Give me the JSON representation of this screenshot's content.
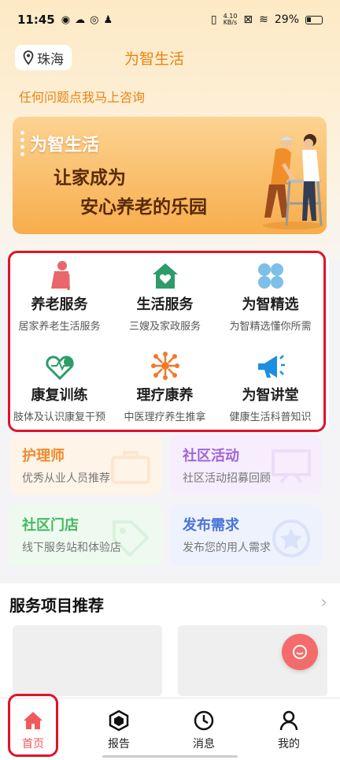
{
  "status_bar": {
    "time": "11:45",
    "net_speed_value": "4.10",
    "net_speed_unit": "KB/s",
    "battery": "29%"
  },
  "header": {
    "location": "珠海",
    "app_title": "为智生活",
    "consult_link": "任何问题点我马上咨询"
  },
  "banner": {
    "title": "为智生活",
    "line1": "让家成为",
    "line2": "安心养老的乐园"
  },
  "services": [
    {
      "title": "养老服务",
      "subtitle": "居家养老生活服务",
      "icon": "elderly-icon"
    },
    {
      "title": "生活服务",
      "subtitle": "三嫂及家政服务",
      "icon": "home-heart-icon"
    },
    {
      "title": "为智精选",
      "subtitle": "为智精选懂你所需",
      "icon": "clover-icon"
    },
    {
      "title": "康复训练",
      "subtitle": "肢体及认识康复干预",
      "icon": "heart-rehab-icon"
    },
    {
      "title": "理疗康养",
      "subtitle": "中医理疗养生推拿",
      "icon": "molecule-icon"
    },
    {
      "title": "为智讲堂",
      "subtitle": "健康生活科普知识",
      "icon": "megaphone-icon"
    }
  ],
  "features": [
    {
      "title": "护理师",
      "subtitle": "优秀从业人员推荐",
      "color": "#f08a2c"
    },
    {
      "title": "社区活动",
      "subtitle": "社区活动招募回顾",
      "color": "#a066d8"
    },
    {
      "title": "社区门店",
      "subtitle": "线下服务站和体验店",
      "color": "#45b95e"
    },
    {
      "title": "发布需求",
      "subtitle": "发布您的用人需求",
      "color": "#4a74d8"
    }
  ],
  "recommend": {
    "heading": "服务项目推荐"
  },
  "tabs": [
    {
      "label": "首页",
      "icon": "home-icon",
      "active": true
    },
    {
      "label": "报告",
      "icon": "report-icon",
      "active": false
    },
    {
      "label": "消息",
      "icon": "clock-icon",
      "active": false
    },
    {
      "label": "我的",
      "icon": "user-icon",
      "active": false
    }
  ],
  "colors": {
    "accent": "#e88512",
    "tab_active": "#f05a5a",
    "highlight": "#e0122c"
  }
}
